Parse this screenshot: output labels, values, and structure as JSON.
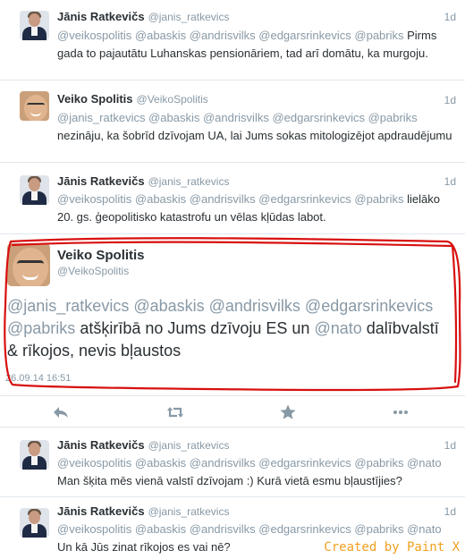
{
  "tweets": [
    {
      "name": "Jānis Ratkevičs",
      "handle": "@janis_ratkevics",
      "time": "1d",
      "mentions": "@veikospolitis @abaskis @andrisvilks @edgarsrinkevics @pabriks",
      "text": "Pirms gada to pajautātu Luhanskas pensionāriem, tad arī domātu, ka murgoju."
    },
    {
      "name": "Veiko Spolitis",
      "handle": "@VeikoSpolitis",
      "time": "1d",
      "mentions": "@janis_ratkevics @abaskis @andrisvilks @edgarsrinkevics @pabriks",
      "text": "nezināju, ka šobrīd dzīvojam UA, lai Jums sokas mitologizējot apdraudējumu"
    },
    {
      "name": "Jānis Ratkevičs",
      "handle": "@janis_ratkevics",
      "time": "1d",
      "mentions": "@veikospolitis @abaskis @andrisvilks @edgarsrinkevics @pabriks",
      "text": "lielāko 20. gs. ģeopolitisko katastrofu un vēlas kļūdas labot."
    },
    {
      "name": "Jānis Ratkevičs",
      "handle": "@janis_ratkevics",
      "time": "1d",
      "mentions": "@veikospolitis @abaskis @andrisvilks @edgarsrinkevics @pabriks @nato",
      "text": "Man šķita mēs vienā valstī dzīvojam :) Kurā vietā esmu bļaustījies?"
    },
    {
      "name": "Jānis Ratkevičs",
      "handle": "@janis_ratkevics",
      "time": "1d",
      "mentions": "@veikospolitis @abaskis @andrisvilks @edgarsrinkevics @pabriks @nato",
      "text": "Un kā Jūs zinat rīkojos es vai nē?"
    }
  ],
  "expanded": {
    "name": "Veiko Spolitis",
    "handle": "@VeikoSpolitis",
    "line1": "@janis_ratkevics @abaskis @andrisvilks @edgarsrinkevics",
    "mention_pabriks": "@pabriks",
    "text_a": " atšķirībā no Jums dzīvoju ES un ",
    "mention_nato": "@nato",
    "text_b": " dalībvalstī",
    "line3": "& rīkojos, nevis bļaustos",
    "date": "26.09.14 16:51"
  },
  "actions": [
    "reply-icon",
    "retweet-icon",
    "favorite-icon",
    "more-icon"
  ],
  "watermark": "Created by Paint X",
  "colors": {
    "mention": "#8899a6",
    "outline": "#d81010",
    "watermark": "#f0a020"
  }
}
